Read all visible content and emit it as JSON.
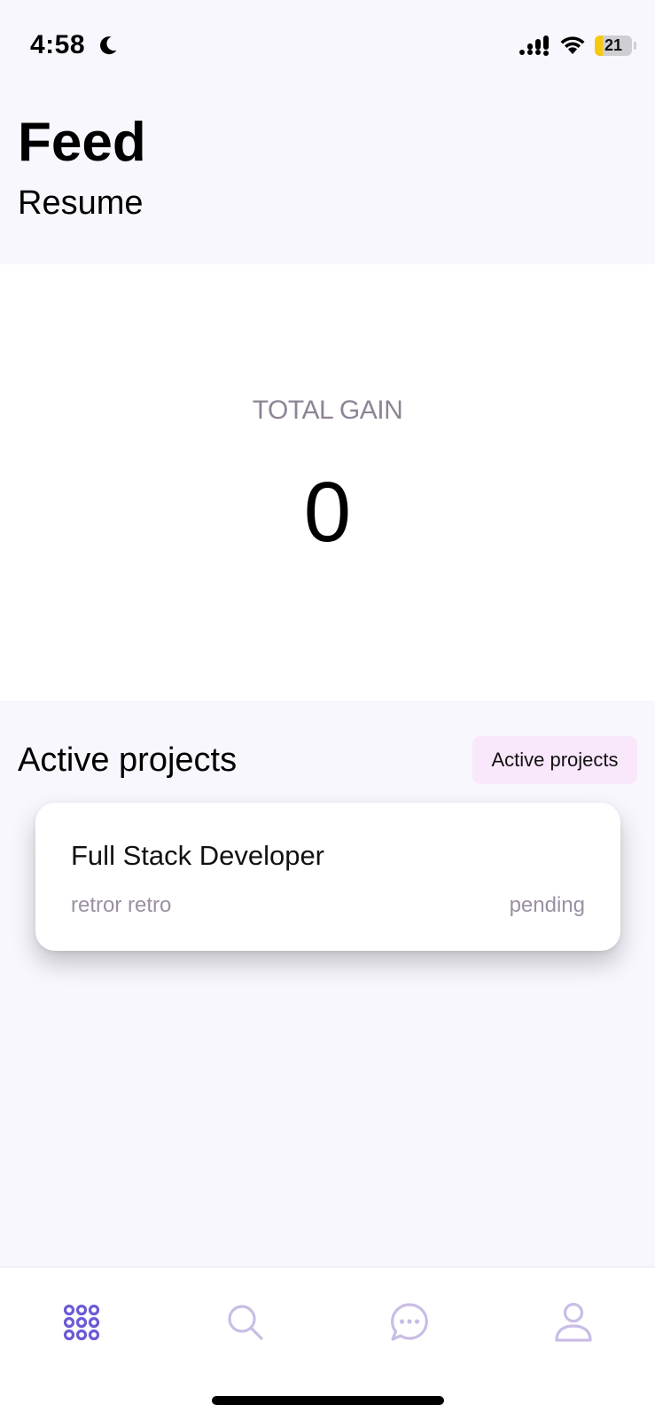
{
  "status_bar": {
    "time": "4:58",
    "battery_level": "21",
    "battery_fraction": 0.21,
    "icons": [
      "moon-icon",
      "signal-icon",
      "wifi-icon",
      "battery-icon"
    ]
  },
  "header": {
    "title": "Feed",
    "subtitle": "Resume"
  },
  "gain": {
    "label": "TOTAL GAIN",
    "value": "0"
  },
  "active_projects": {
    "title": "Active projects",
    "chip_label": "Active projects",
    "items": [
      {
        "title": "Full Stack Developer",
        "owner": "retror retro",
        "status": "pending"
      }
    ]
  },
  "tab_bar": {
    "tabs": [
      {
        "name": "feed",
        "icon": "grid-icon",
        "active": true
      },
      {
        "name": "search",
        "icon": "search-icon",
        "active": false
      },
      {
        "name": "messages",
        "icon": "chat-icon",
        "active": false
      },
      {
        "name": "profile",
        "icon": "user-icon",
        "active": false
      }
    ],
    "active_color": "#6b5bd6",
    "inactive_color": "#c9bde6"
  }
}
